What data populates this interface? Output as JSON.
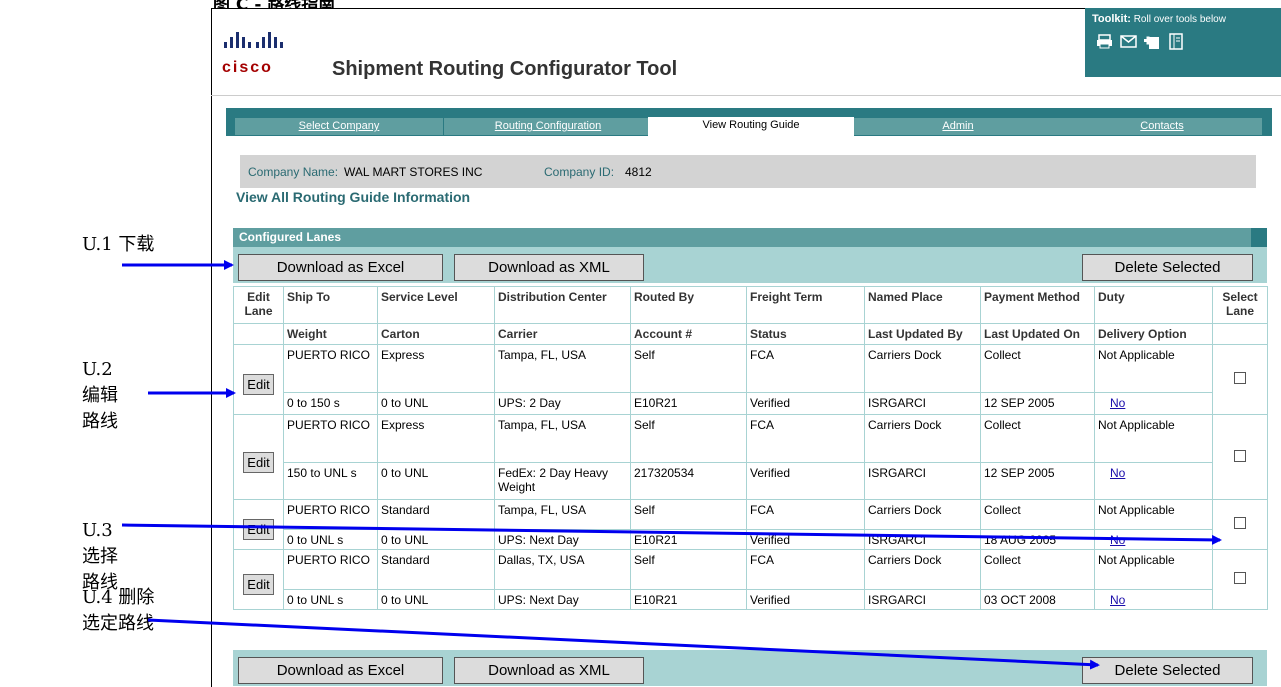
{
  "caption": "图 C - 路线指南",
  "header": {
    "logo_text": "cisco",
    "app_title": "Shipment Routing Configurator Tool"
  },
  "toolkit": {
    "label_bold": "Toolkit:",
    "label_rest": "Roll over tools below",
    "icons": [
      "print-icon",
      "email-icon",
      "add-bookmark-icon",
      "document-icon"
    ]
  },
  "tabs": [
    {
      "label": "Select Company",
      "active": false
    },
    {
      "label": "Routing Configuration",
      "active": false
    },
    {
      "label": "View Routing Guide",
      "active": true
    },
    {
      "label": "Admin",
      "active": false
    },
    {
      "label": "Contacts",
      "active": false
    }
  ],
  "company": {
    "name_label": "Company Name:",
    "name": "WAL MART STORES INC",
    "id_label": "Company ID:",
    "id": "4812"
  },
  "section_title": "View All Routing Guide Information",
  "panel_title": "Configured Lanes",
  "buttons": {
    "excel": "Download as Excel",
    "xml": "Download as XML",
    "delete": "Delete Selected",
    "edit": "Edit"
  },
  "columns_top": [
    "Edit Lane",
    "Ship To",
    "Service Level",
    "Distribution Center",
    "Routed By",
    "Freight Term",
    "Named Place",
    "Payment Method",
    "Duty",
    "Select Lane"
  ],
  "columns_bottom": [
    "Weight",
    "Carton",
    "Carrier",
    "Account #",
    "Status",
    "Last Updated By",
    "Last Updated On",
    "Delivery Option"
  ],
  "lanes": [
    {
      "ship_to": "PUERTO RICO",
      "service": "Express",
      "dc": "Tampa, FL, USA",
      "routed_by": "Self",
      "freight": "FCA",
      "named_place": "Carriers Dock",
      "payment": "Collect",
      "duty": "Not Applicable",
      "weight": "0 to 150 s",
      "carton": "0 to UNL",
      "carrier": "UPS: 2 Day",
      "account": "E10R21",
      "status": "Verified",
      "updated_by": "ISRGARCI",
      "updated_on": "12 SEP 2005",
      "delivery": "No"
    },
    {
      "ship_to": "PUERTO RICO",
      "service": "Express",
      "dc": "Tampa, FL, USA",
      "routed_by": "Self",
      "freight": "FCA",
      "named_place": "Carriers Dock",
      "payment": "Collect",
      "duty": "Not Applicable",
      "weight": "150 to UNL s",
      "carton": "0 to UNL",
      "carrier": "FedEx: 2 Day Heavy Weight",
      "account": "217320534",
      "status": "Verified",
      "updated_by": "ISRGARCI",
      "updated_on": "12 SEP 2005",
      "delivery": "No"
    },
    {
      "ship_to": "PUERTO RICO",
      "service": "Standard",
      "dc": "Tampa, FL, USA",
      "routed_by": "Self",
      "freight": "FCA",
      "named_place": "Carriers Dock",
      "payment": "Collect",
      "duty": "Not Applicable",
      "weight": "0 to UNL s",
      "carton": "0 to UNL",
      "carrier": "UPS: Next Day",
      "account": "E10R21",
      "status": "Verified",
      "updated_by": "ISRGARCI",
      "updated_on": "18 AUG 2005",
      "delivery": "No"
    },
    {
      "ship_to": "PUERTO RICO",
      "service": "Standard",
      "dc": "Dallas, TX, USA",
      "routed_by": "Self",
      "freight": "FCA",
      "named_place": "Carriers Dock",
      "payment": "Collect",
      "duty": "Not Applicable",
      "weight": "0 to UNL s",
      "carton": "0 to UNL",
      "carrier": "UPS: Next Day",
      "account": "E10R21",
      "status": "Verified",
      "updated_by": "ISRGARCI",
      "updated_on": "03 OCT 2008",
      "delivery": "No"
    }
  ],
  "annotations": [
    {
      "text": "U.1 下载"
    },
    {
      "text": "U.2 编辑 路线"
    },
    {
      "text": "U.3 选择 路线"
    },
    {
      "text": "U.4 删除 选定路线"
    }
  ],
  "colors": {
    "teal_dark": "#2a7a82",
    "teal_tab": "#5f9ea0",
    "teal_light": "#a8d3d3",
    "arrow": "#0000ee",
    "cisco_red": "#a40000"
  }
}
